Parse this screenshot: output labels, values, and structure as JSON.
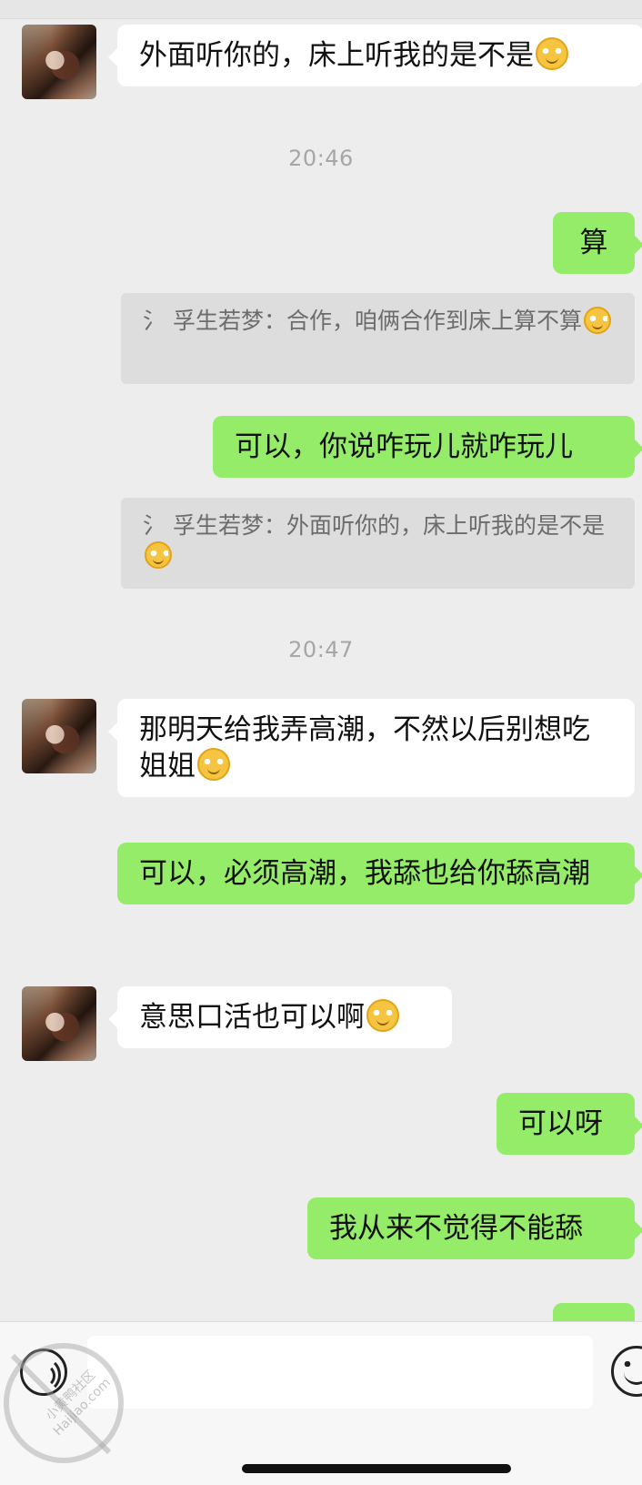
{
  "messages": {
    "m1_text": "外面听你的，床上听我的是不是",
    "time1": "20:46",
    "m2_text": "算",
    "q1_text": "氵 孚生若梦：合作，咱俩合作到床上算不算",
    "m3_text": "可以，你说咋玩儿就咋玩儿",
    "q2_text": "氵 孚生若梦：外面听你的，床上听我的是不是",
    "time2": "20:47",
    "m4_text": "那明天给我弄高潮，不然以后别想吃姐姐",
    "m5_text": "可以，必须高潮，我舔也给你舔高潮",
    "m6_text": "意思口活也可以啊",
    "m7_text": "可以呀",
    "m8_text": "我从来不觉得不能舔"
  },
  "watermark": {
    "line1": "小黄鸭社区",
    "line2": "Haijiao.com"
  },
  "colors": {
    "background": "#ededed",
    "incoming_bubble": "#ffffff",
    "outgoing_bubble": "#95ec69",
    "quote_bg": "#dddddd",
    "timestamp": "#a6a6a6"
  },
  "icons": {
    "emoji": "smirk-face-icon",
    "voice": "voice-icon",
    "emoji_button": "smile-face-icon"
  }
}
